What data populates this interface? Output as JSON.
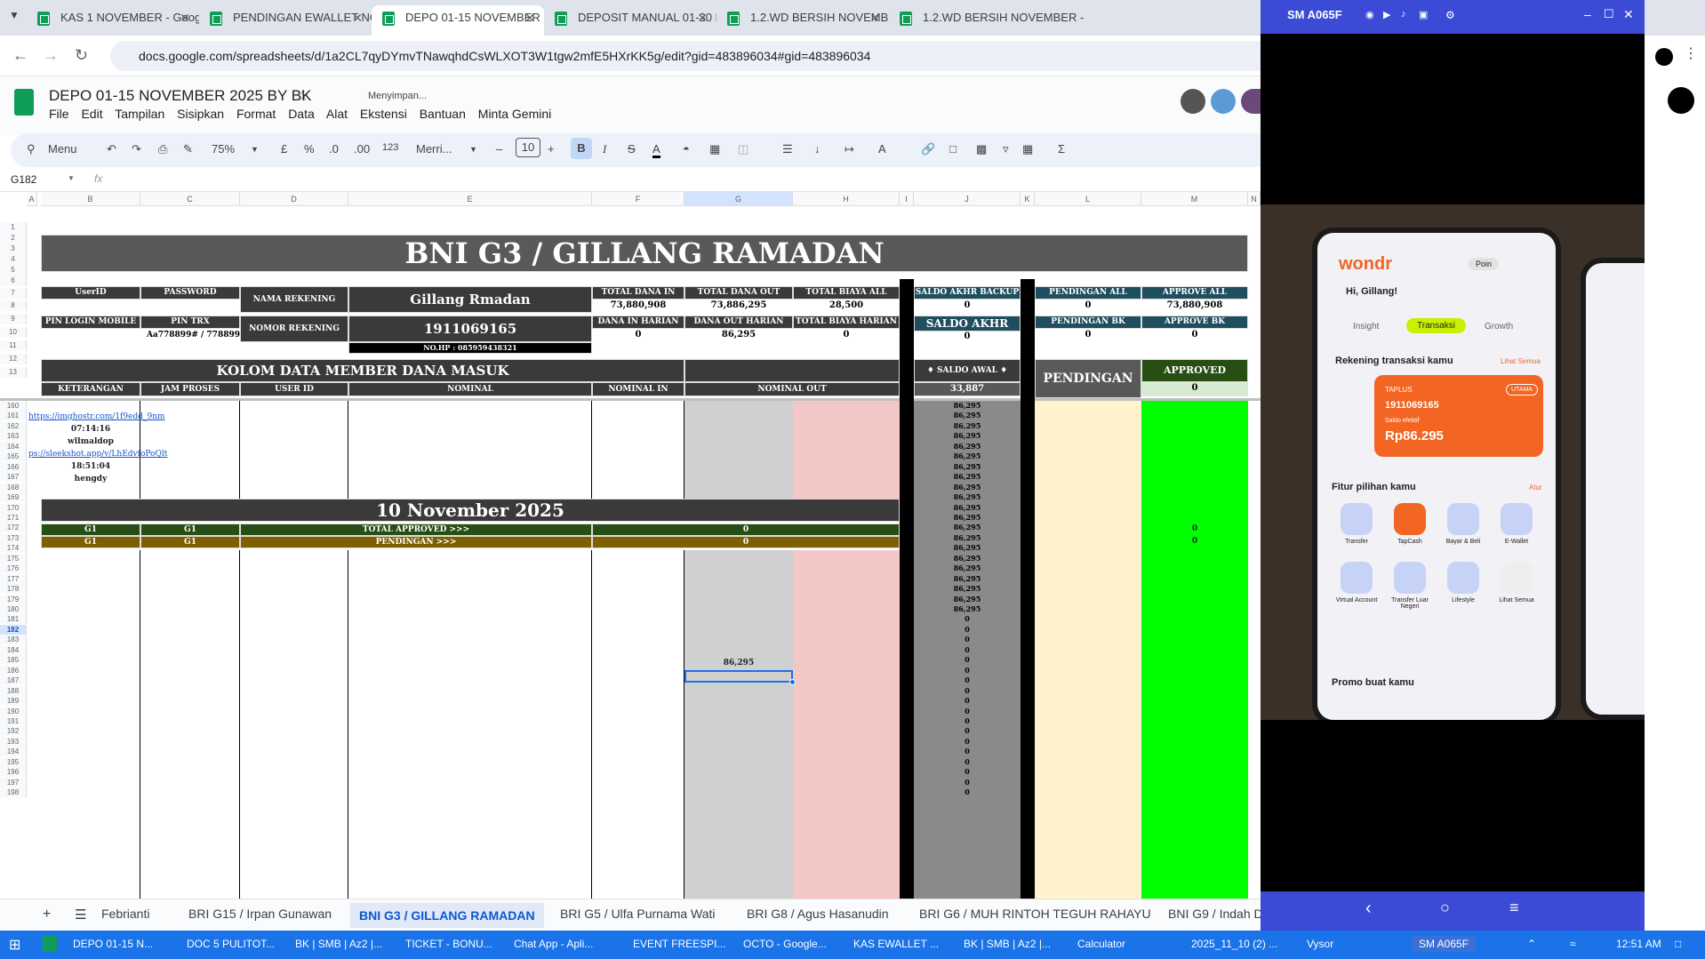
{
  "browser": {
    "tabs": [
      {
        "label": "KAS 1 NOVEMBER - Google Sp"
      },
      {
        "label": "PENDINGAN EWALLET NOVEM"
      },
      {
        "label": "DEPO 01-15 NOVEMBER 2025"
      },
      {
        "label": "DEPOSIT MANUAL 01-30 NOVE"
      },
      {
        "label": "1.2.WD BERSIH NOVEMBER - G"
      },
      {
        "label": "1.2.WD BERSIH NOVEMBER -"
      }
    ],
    "url": "docs.google.com/spreadsheets/d/1a2CL7qyDYmvTNawqhdCsWLXOT3W1tgw2mfE5HXrKK5g/edit?gid=483896034#gid=483896034"
  },
  "doc": {
    "title": "DEPO 01-15 NOVEMBER 2025 BY BK",
    "saving": "Menyimpan...",
    "menu": [
      "File",
      "Edit",
      "Tampilan",
      "Sisipkan",
      "Format",
      "Data",
      "Alat",
      "Ekstensi",
      "Bantuan",
      "Minta Gemini"
    ]
  },
  "toolbar": {
    "menu_label": "Menu",
    "zoom": "75%",
    "currency": "£",
    "percent": "%",
    "dec_minus": ".0",
    "dec_plus": ".00",
    "num123": "123",
    "font": "Merri...",
    "size": "10"
  },
  "formula": {
    "cell_ref": "G182",
    "fx": "fx"
  },
  "columns": [
    "A",
    "B",
    "C",
    "D",
    "E",
    "F",
    "G",
    "H",
    "I",
    "J",
    "K",
    "L",
    "M",
    "N"
  ],
  "sheet": {
    "banner": "BNI G3 / GILLANG RAMADAN",
    "userid_label": "UserID",
    "password_label": "PASSWORD",
    "nama_rekening_label": "NAMA REKENING",
    "nama_rekening": "Gillang Rmadan",
    "pin_login_label": "PIN LOGIN MOBILE",
    "pin_trx_label": "PIN TRX",
    "pin_trx": "Aa778899# / 778899",
    "nomor_rekening_label": "NOMOR REKENING",
    "nomor_rekening": "1911069165",
    "nohp": "NO.HP : 085959438321",
    "total_dana_in_label": "TOTAL DANA IN",
    "total_dana_in": "73,880,908",
    "total_dana_out_label": "TOTAL DANA OUT",
    "total_dana_out": "73,886,295",
    "total_biaya_all_label": "TOTAL BIAYA ALL",
    "total_biaya_all": "28,500",
    "dana_in_harian_label": "DANA IN HARIAN",
    "dana_in_harian": "0",
    "dana_out_harian_label": "DANA OUT HARIAN",
    "dana_out_harian": "86,295",
    "total_biaya_harian_label": "TOTAL BIAYA HARIAN",
    "total_biaya_harian": "0",
    "saldo_akhir_backup_label": "SALDO AKHR BACKUP",
    "saldo_akhir_backup": "0",
    "saldo_akhir_label": "SALDO AKHR",
    "saldo_akhir": "0",
    "pendingan_all_label": "PENDINGAN ALL",
    "pendingan_all": "0",
    "approve_all_label": "APPROVE ALL",
    "approve_all": "73,880,908",
    "pendingan_bk_label": "PENDINGAN BK",
    "pendingan_bk": "0",
    "approve_bk_label": "APPROVE BK",
    "approve_bk": "0",
    "kolom_title": "KOLOM DATA MEMBER DANA MASUK",
    "saldo_awal_label": "♦ SALDO AWAL ♦",
    "saldo_awal": "33,887",
    "pendingan_header": "PENDINGAN",
    "approved_header": "APPROVED",
    "approved_value": "0",
    "col_keterangan": "KETERANGAN",
    "col_jam": "JAM PROSES",
    "col_userid": "USER ID",
    "col_nominal": "NOMINAL",
    "col_nominal_in": "NOMINAL IN",
    "col_nominal_out": "NOMINAL OUT",
    "link1": "https://imghostr.com/1f9edd_9nm",
    "time1": "07:14:16",
    "user1": "wllmaldop",
    "link2": "ps://sleekshot.app/v/LhEdvfoPoQlt",
    "time2": "18:51:04",
    "user2": "hengdy",
    "date_banner": "10 November 2025",
    "g1a": "G1",
    "g1b": "G1",
    "g1c": "G1",
    "g1d": "G1",
    "total_approved_label": "TOTAL APPROVED >>>",
    "total_approved": "0",
    "pendingan_label": "PENDINGAN >>>",
    "pendingan_value": "0",
    "approved_m170": "0",
    "approved_m171": "0",
    "g181": "86,295",
    "saldo_running": "86,295",
    "zero": "0"
  },
  "rows_top": [
    "1",
    "2",
    "3",
    "4",
    "5",
    "6",
    "7",
    "8",
    "9",
    "10",
    "11",
    "12",
    "13"
  ],
  "rows_bottom": [
    "160",
    "161",
    "162",
    "163",
    "164",
    "165",
    "166",
    "167",
    "168",
    "169",
    "170",
    "171",
    "172",
    "173",
    "174",
    "175",
    "176",
    "177",
    "178",
    "179",
    "180",
    "181",
    "182",
    "183",
    "184",
    "185",
    "186",
    "187",
    "188",
    "189",
    "190",
    "191",
    "192",
    "193",
    "194",
    "195",
    "196",
    "197",
    "198"
  ],
  "sheet_tabs": [
    "Febrianti",
    "BRI G15 / Irpan Gunawan",
    "BNI G3 / GILLANG RAMADAN",
    "BRI G5 / Ulfa Purnama Wati",
    "BRI G8 / Agus Hasanudin",
    "BRI G6 / MUH RINTOH TEGUH RAHAYU",
    "BNI G9 / Indah D"
  ],
  "phone": {
    "title": "SM A065F",
    "app_greeting": "Hi, Gillang!",
    "tab_insight": "Insight",
    "tab_transaksi": "Transaksi",
    "tab_growth": "Growth",
    "rekening_title": "Rekening transaksi kamu",
    "lihat_semua": "Lihat Semua",
    "card_label": "TAPLUS",
    "card_number": "1911069165",
    "card_saldo_label": "Saldo efektif",
    "card_balance": "Rp86.295",
    "card_badge": "UTAMA",
    "fitur_title": "Fitur pilihan kamu",
    "atur": "Atur",
    "features": [
      "Transfer",
      "TapCash",
      "Bayar & Beli",
      "E-Wallet",
      "Virtual Account",
      "Transfer Luar Negeri",
      "Lifestyle",
      "Lihat Semua"
    ],
    "promo_title": "Promo buat kamu",
    "brand": "wondr",
    "poin": "Poin"
  },
  "taskbar": {
    "items": [
      "DEPO 01-15 N...",
      "DOC 5 PULITOT...",
      "BK | SMB | Az2 |...",
      "TICKET - BONU...",
      "Chat App - Apli...",
      "EVENT FREESPI...",
      "OCTO - Google...",
      "KAS EWALLET ...",
      "BK | SMB | Az2 |...",
      "Calculator",
      "2025_11_10 (2) ...",
      "Vysor",
      "SM A065F"
    ],
    "time": "12:51 AM"
  },
  "colors": {
    "dark_header": "#3a3a3a",
    "grey_col": "#d0d0d0",
    "pink_col": "#f4c7c7",
    "saldo_col": "#8a8a8a",
    "pending_col": "#fff2cc",
    "approved_col": "#00ff00",
    "total_approved_green": "#274e13",
    "pendingan_gold": "#7f6000",
    "taskbar_blue": "#1a73e8",
    "phone_blue": "#3b4bd6"
  }
}
